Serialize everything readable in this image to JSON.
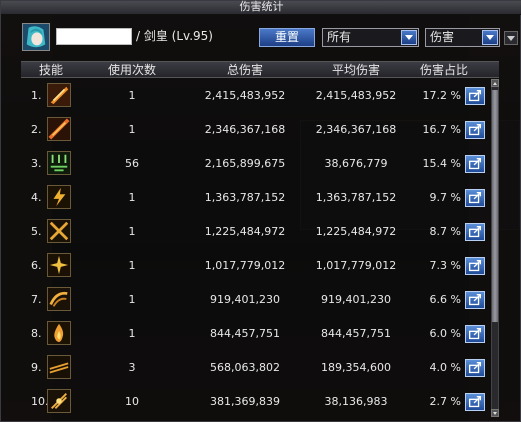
{
  "window": {
    "title": "伤害统计"
  },
  "character": {
    "info": "/ 剑皇 (Lv.95)"
  },
  "controls": {
    "reset_label": "重置",
    "filter_value": "所有",
    "type_value": "伤害"
  },
  "table": {
    "headers": [
      "技能",
      "使用次数",
      "总伤害",
      "平均伤害",
      "伤害占比"
    ],
    "rows": [
      {
        "rank": "1.",
        "icon": "slash-skill-icon",
        "count": "1",
        "total": "2,415,483,952",
        "avg": "2,415,483,952",
        "pct": "17.2 %"
      },
      {
        "rank": "2.",
        "icon": "blade-skill-icon",
        "count": "1",
        "total": "2,346,367,168",
        "avg": "2,346,367,168",
        "pct": "16.7 %"
      },
      {
        "rank": "3.",
        "icon": "multi-sword-skill-icon",
        "count": "56",
        "total": "2,165,899,675",
        "avg": "38,676,779",
        "pct": "15.4 %"
      },
      {
        "rank": "4.",
        "icon": "flash-skill-icon",
        "count": "1",
        "total": "1,363,787,152",
        "avg": "1,363,787,152",
        "pct": "9.7 %"
      },
      {
        "rank": "5.",
        "icon": "cross-slash-skill-icon",
        "count": "1",
        "total": "1,225,484,972",
        "avg": "1,225,484,972",
        "pct": "8.7 %"
      },
      {
        "rank": "6.",
        "icon": "burst-skill-icon",
        "count": "1",
        "total": "1,017,779,012",
        "avg": "1,017,779,012",
        "pct": "7.3 %"
      },
      {
        "rank": "7.",
        "icon": "wave-slash-skill-icon",
        "count": "1",
        "total": "919,401,230",
        "avg": "919,401,230",
        "pct": "6.6 %"
      },
      {
        "rank": "8.",
        "icon": "flame-skill-icon",
        "count": "1",
        "total": "844,457,751",
        "avg": "844,457,751",
        "pct": "6.0 %"
      },
      {
        "rank": "9.",
        "icon": "dash-slash-skill-icon",
        "count": "3",
        "total": "568,063,802",
        "avg": "189,354,600",
        "pct": "4.0 %"
      },
      {
        "rank": "10.",
        "icon": "sword-dance-skill-icon",
        "count": "10",
        "total": "381,369,839",
        "avg": "38,136,983",
        "pct": "2.7 %"
      }
    ]
  },
  "colors": {
    "accent_blue": "#2a5cb0",
    "icon_gold": "#e0a030",
    "icon_green": "#6ed060"
  }
}
